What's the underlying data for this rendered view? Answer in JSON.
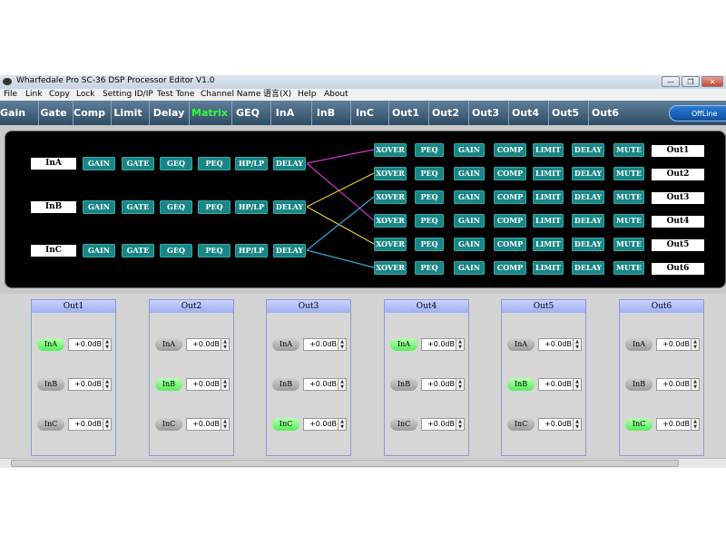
{
  "window": {
    "title": "Wharfedale Pro SC-36 DSP Processor Editor V1.0",
    "minimize": "—",
    "maximize": "❐",
    "close": "✕"
  },
  "menu": [
    "File",
    "Link",
    "Copy",
    "Lock",
    "Setting ID/IP",
    "Test Tone",
    "Channel Name",
    "语言(X)",
    "Help",
    "About"
  ],
  "tabs": [
    "Gain",
    "Gate",
    "Comp",
    "Limit",
    "Delay",
    "Matrix",
    "GEQ",
    "InA",
    "InB",
    "InC",
    "Out1",
    "Out2",
    "Out3",
    "Out4",
    "Out5",
    "Out6"
  ],
  "active_tab": "Matrix",
  "status_button": "OffLine",
  "routing": {
    "inputs": [
      {
        "name": "InA",
        "modules": [
          "GAIN",
          "GATE",
          "GEQ",
          "PEQ",
          "HP/LP",
          "DELAY"
        ]
      },
      {
        "name": "InB",
        "modules": [
          "GAIN",
          "GATE",
          "GEQ",
          "PEQ",
          "HP/LP",
          "DELAY"
        ]
      },
      {
        "name": "InC",
        "modules": [
          "GAIN",
          "GATE",
          "GEQ",
          "PEQ",
          "HP/LP",
          "DELAY"
        ]
      }
    ],
    "outputs": [
      {
        "name": "Out1",
        "modules": [
          "XOVER",
          "PEQ",
          "GAIN",
          "COMP",
          "LIMIT",
          "DELAY",
          "MUTE"
        ]
      },
      {
        "name": "Out2",
        "modules": [
          "XOVER",
          "PEQ",
          "GAIN",
          "COMP",
          "LIMIT",
          "DELAY",
          "MUTE"
        ]
      },
      {
        "name": "Out3",
        "modules": [
          "XOVER",
          "PEQ",
          "GAIN",
          "COMP",
          "LIMIT",
          "DELAY",
          "MUTE"
        ]
      },
      {
        "name": "Out4",
        "modules": [
          "XOVER",
          "PEQ",
          "GAIN",
          "COMP",
          "LIMIT",
          "DELAY",
          "MUTE"
        ]
      },
      {
        "name": "Out5",
        "modules": [
          "XOVER",
          "PEQ",
          "GAIN",
          "COMP",
          "LIMIT",
          "DELAY",
          "MUTE"
        ]
      },
      {
        "name": "Out6",
        "modules": [
          "XOVER",
          "PEQ",
          "GAIN",
          "COMP",
          "LIMIT",
          "DELAY",
          "MUTE"
        ]
      }
    ],
    "links": [
      {
        "from": "InA",
        "to": "Out1",
        "color": "#cc33cc"
      },
      {
        "from": "InA",
        "to": "Out4",
        "color": "#cc33cc"
      },
      {
        "from": "InB",
        "to": "Out2",
        "color": "#e6cc33"
      },
      {
        "from": "InB",
        "to": "Out5",
        "color": "#e6cc33"
      },
      {
        "from": "InC",
        "to": "Out3",
        "color": "#33aadd"
      },
      {
        "from": "InC",
        "to": "Out6",
        "color": "#33aadd"
      }
    ]
  },
  "matrix": [
    {
      "out": "Out1",
      "rows": [
        {
          "in": "InA",
          "on": true,
          "gain": "+0.0dB"
        },
        {
          "in": "InB",
          "on": false,
          "gain": "+0.0dB"
        },
        {
          "in": "InC",
          "on": false,
          "gain": "+0.0dB"
        }
      ]
    },
    {
      "out": "Out2",
      "rows": [
        {
          "in": "InA",
          "on": false,
          "gain": "+0.0dB"
        },
        {
          "in": "InB",
          "on": true,
          "gain": "+0.0dB"
        },
        {
          "in": "InC",
          "on": false,
          "gain": "+0.0dB"
        }
      ]
    },
    {
      "out": "Out3",
      "rows": [
        {
          "in": "InA",
          "on": false,
          "gain": "+0.0dB"
        },
        {
          "in": "InB",
          "on": false,
          "gain": "+0.0dB"
        },
        {
          "in": "InC",
          "on": true,
          "gain": "+0.0dB"
        }
      ]
    },
    {
      "out": "Out4",
      "rows": [
        {
          "in": "InA",
          "on": true,
          "gain": "+0.0dB"
        },
        {
          "in": "InB",
          "on": false,
          "gain": "+0.0dB"
        },
        {
          "in": "InC",
          "on": false,
          "gain": "+0.0dB"
        }
      ]
    },
    {
      "out": "Out5",
      "rows": [
        {
          "in": "InA",
          "on": false,
          "gain": "+0.0dB"
        },
        {
          "in": "InB",
          "on": true,
          "gain": "+0.0dB"
        },
        {
          "in": "InC",
          "on": false,
          "gain": "+0.0dB"
        }
      ]
    },
    {
      "out": "Out6",
      "rows": [
        {
          "in": "InA",
          "on": false,
          "gain": "+0.0dB"
        },
        {
          "in": "InB",
          "on": false,
          "gain": "+0.0dB"
        },
        {
          "in": "InC",
          "on": true,
          "gain": "+0.0dB"
        }
      ]
    }
  ],
  "colors": {
    "module": "#1a8585",
    "active_tab": "#33ff33",
    "input_on": "#55ee55",
    "input_off": "#a8a8a8",
    "panel_bg": "#000000",
    "tabbar": "#3f5e7a"
  }
}
